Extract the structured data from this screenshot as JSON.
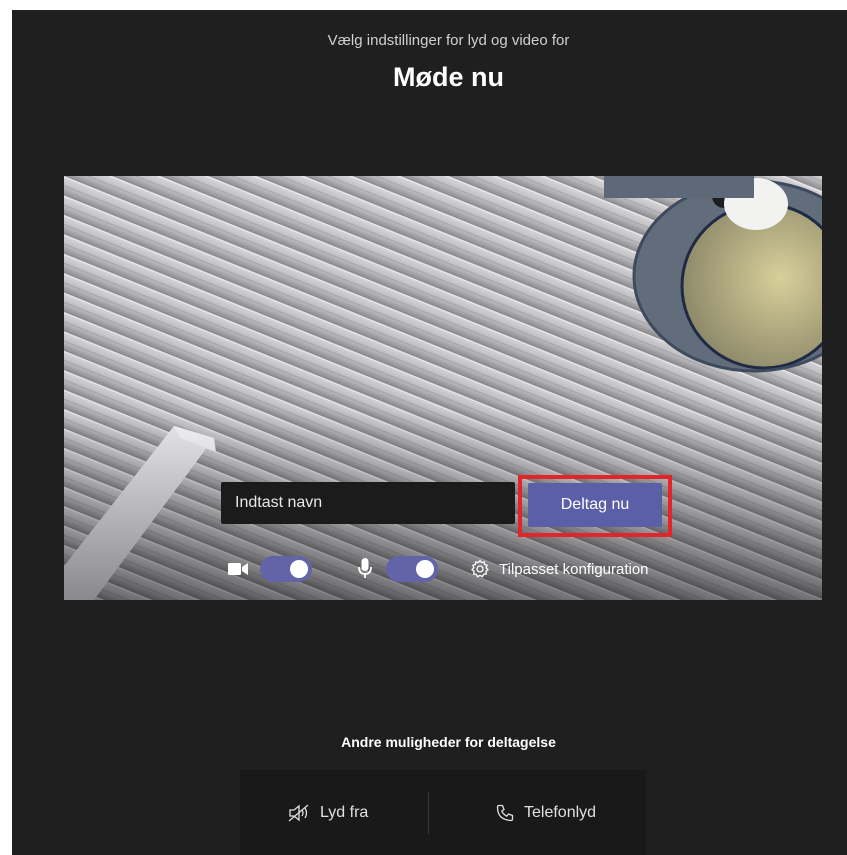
{
  "header": {
    "subtitle": "Vælg indstillinger for lyd og video for",
    "meeting_title": "Møde nu"
  },
  "join": {
    "name_placeholder": "Indtast navn",
    "name_value": "",
    "join_label": "Deltag nu"
  },
  "controls": {
    "camera_on": true,
    "mic_on": true,
    "custom_config_label": "Tilpasset konfiguration"
  },
  "other_options": {
    "title": "Andre muligheder for deltagelse",
    "audio_off_label": "Lyd fra",
    "phone_audio_label": "Telefonlyd"
  },
  "colors": {
    "background": "#201f1f",
    "accent": "#6264a7",
    "join_button": "#5b5fa8",
    "highlight": "#e3242b"
  },
  "icons": [
    "camera-icon",
    "microphone-icon",
    "gear-icon",
    "speaker-off-icon",
    "phone-icon"
  ]
}
